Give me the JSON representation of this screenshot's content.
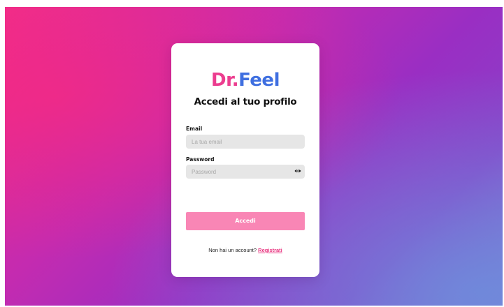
{
  "brand": {
    "logo_part1": "Dr.",
    "logo_part2": "Feel",
    "colors": {
      "pink": "#ec3d8f",
      "blue": "#3f6fe0"
    }
  },
  "login": {
    "title": "Accedi al tuo profilo",
    "email_label": "Email",
    "email_placeholder": "La tua email",
    "email_value": "",
    "password_label": "Password",
    "password_placeholder": "Password",
    "password_value": "",
    "password_toggle_icon": "eye-icon",
    "submit_label": "Accedi",
    "submit_color": "#f986b5",
    "signup_prompt": "Non hai un account?",
    "signup_link": "Registrati"
  }
}
